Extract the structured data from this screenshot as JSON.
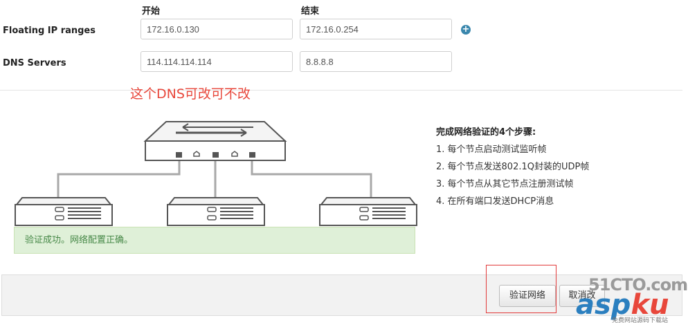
{
  "columns": {
    "start": "开始",
    "end": "结束"
  },
  "floating_ip": {
    "label": "Floating IP ranges",
    "start_value": "172.16.0.130",
    "end_value": "172.16.0.254",
    "add_icon": "plus-circle-icon"
  },
  "dns": {
    "label": "DNS Servers",
    "primary_value": "114.114.114.114",
    "secondary_value": "8.8.8.8"
  },
  "annotation": "这个DNS可改可不改",
  "verify_steps": {
    "title": "完成网络验证的4个步骤:",
    "items": [
      "1. 每个节点启动测试监听帧",
      "2. 每个节点发送802.1Q封装的UDP帧",
      "3. 每个节点从其它节点注册测试帧",
      "4. 在所有端口发送DHCP消息"
    ]
  },
  "success_message": "验证成功。网络配置正确。",
  "buttons": {
    "verify": "验证网络",
    "cancel": "取消改"
  },
  "watermark": {
    "site": "51CTO.com",
    "brand_a": "asp",
    "brand_b": "ku",
    "tagline": "免费网站源码下载站"
  },
  "colors": {
    "accent": "#3a87ad",
    "annotation_red": "#e8473b",
    "success_bg": "#dff0d8",
    "success_text": "#468847"
  }
}
